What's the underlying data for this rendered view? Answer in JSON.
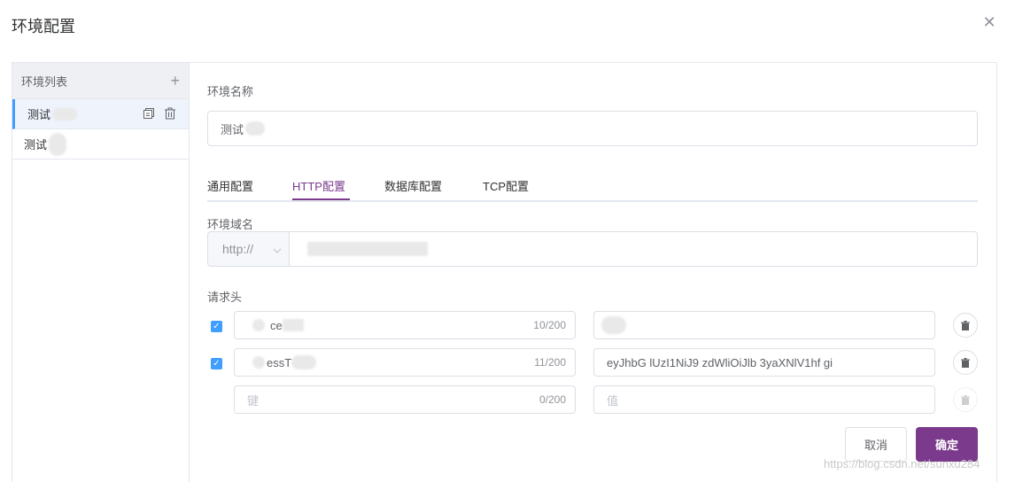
{
  "dialog": {
    "title": "环境配置"
  },
  "sidebar": {
    "header": "环境列表",
    "items": [
      {
        "label": "测试"
      },
      {
        "label": "测试"
      }
    ]
  },
  "form": {
    "env_name_label": "环境名称",
    "env_name_value": "测试",
    "tabs": [
      {
        "label": "通用配置"
      },
      {
        "label": "HTTP配置"
      },
      {
        "label": "数据库配置"
      },
      {
        "label": "TCP配置"
      }
    ],
    "domain_label": "环境域名",
    "protocol": "http://",
    "headers_label": "请求头",
    "headers": [
      {
        "key": "ce",
        "count": "10/200",
        "value": "",
        "checked": true
      },
      {
        "key": "essT",
        "count": "11/200",
        "value": "eyJhbG  lUzI1NiJ9  zdWliOiJlb  3yaXNlV1hf  gi",
        "checked": true
      },
      {
        "key": "",
        "count": "0/200",
        "value": "",
        "checked": false
      }
    ],
    "key_placeholder": "键",
    "value_placeholder": "值"
  },
  "footer": {
    "cancel": "取消",
    "confirm": "确定"
  },
  "watermark": "https://blog.csdn.net/sunxu284",
  "colors": {
    "primary": "#7b3a8c",
    "checkbox": "#409eff"
  }
}
